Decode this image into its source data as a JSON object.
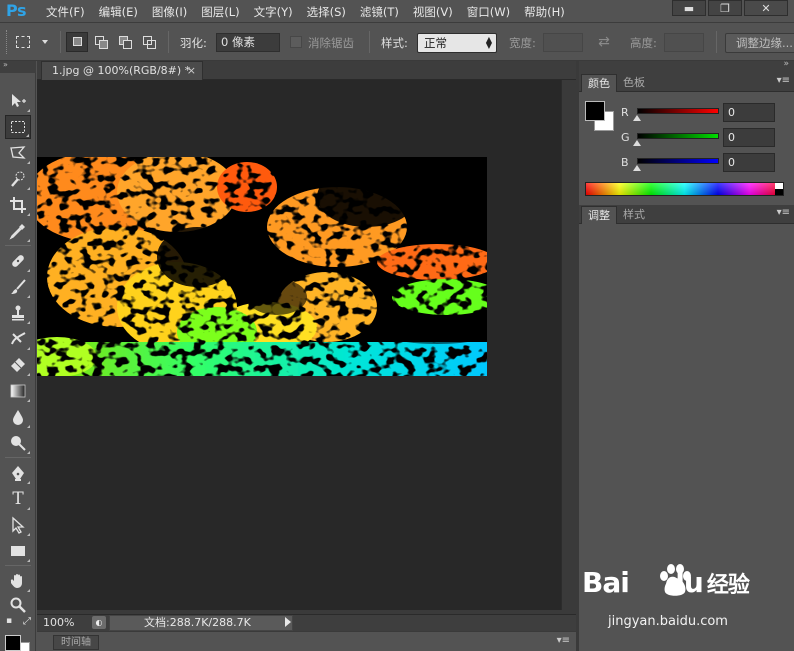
{
  "app": {
    "logo": "Ps"
  },
  "menu": [
    "文件(F)",
    "编辑(E)",
    "图像(I)",
    "图层(L)",
    "文字(Y)",
    "选择(S)",
    "滤镜(T)",
    "视图(V)",
    "窗口(W)",
    "帮助(H)"
  ],
  "window_controls": {
    "minimize": "▬",
    "restore": "❐",
    "close": "✕"
  },
  "options_bar": {
    "feather_label": "羽化:",
    "feather_value": "0 像素",
    "antialias_label": "消除锯齿",
    "style_label": "样式:",
    "style_value": "正常",
    "width_label": "宽度:",
    "height_label": "高度:",
    "refine_edge_label": "调整边缘..."
  },
  "document": {
    "tab_title": "1.jpg @ 100%(RGB/8#) *",
    "close_glyph": "×",
    "zoom": "100%",
    "doc_info": "文档:288.7K/288.7K",
    "status_icon": "◐"
  },
  "timeline": {
    "tab_label": "时间轴"
  },
  "color_panel": {
    "tabs": [
      "颜色",
      "色板"
    ],
    "active_tab": "颜色",
    "channels": [
      {
        "label": "R",
        "value": "0",
        "color": "#ff0000"
      },
      {
        "label": "G",
        "value": "0",
        "color": "#00cc00"
      },
      {
        "label": "B",
        "value": "0",
        "color": "#0000ff"
      }
    ],
    "foreground": "#000000",
    "background": "#ffffff"
  },
  "adjust_panel": {
    "tabs": [
      "调整",
      "样式"
    ],
    "active_tab": "调整"
  },
  "tools": [
    "move-tool",
    "marquee-tool",
    "lasso-tool",
    "quick-selection-tool",
    "crop-tool",
    "eyedropper-tool",
    "healing-brush-tool",
    "brush-tool",
    "clone-stamp-tool",
    "history-brush-tool",
    "eraser-tool",
    "gradient-tool",
    "blur-tool",
    "dodge-tool",
    "pen-tool",
    "type-tool",
    "path-selection-tool",
    "rectangle-tool",
    "hand-tool",
    "zoom-tool"
  ],
  "type_tool_glyph": "T",
  "panel_menu_glyph": "▾≡",
  "collapse_glyph": "»",
  "watermark": {
    "logo_left": "Bai",
    "logo_right": "du",
    "logo_cn": "经验",
    "url": "jingyan.baidu.com"
  },
  "colors": {
    "app_bg": "#535353",
    "canvas_bg": "#282828",
    "accent": "#2fa3e6"
  }
}
